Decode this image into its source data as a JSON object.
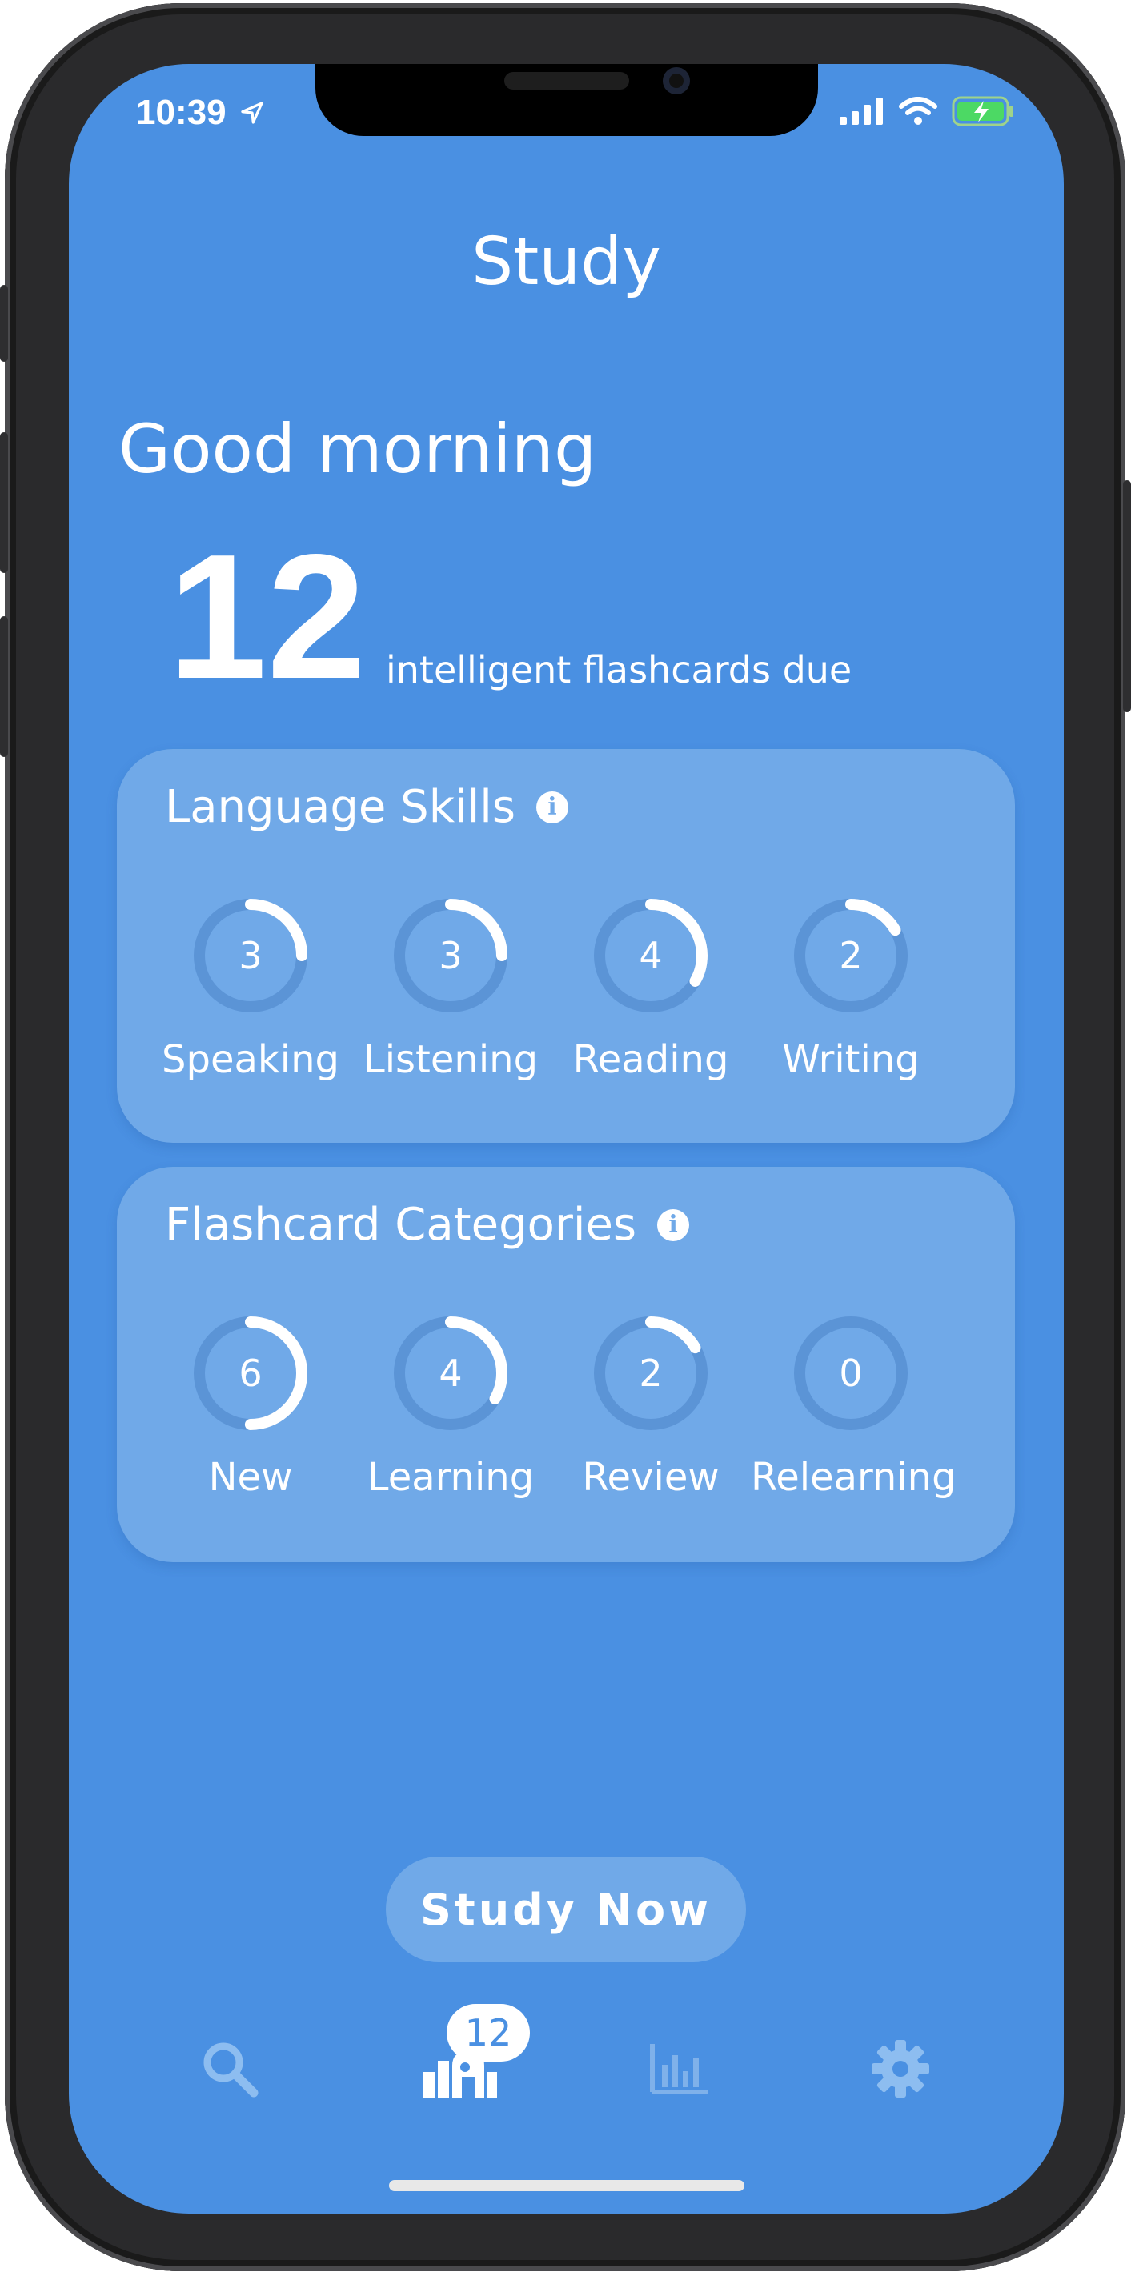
{
  "status_bar": {
    "time": "10:39"
  },
  "header": {
    "title": "Study"
  },
  "greeting": "Good morning",
  "due": {
    "count": "12",
    "label": "intelligent flashcards due"
  },
  "language_skills": {
    "title": "Language Skills",
    "items": [
      {
        "label": "Speaking",
        "value": "3",
        "progress": 0.25
      },
      {
        "label": "Listening",
        "value": "3",
        "progress": 0.25
      },
      {
        "label": "Reading",
        "value": "4",
        "progress": 0.333
      },
      {
        "label": "Writing",
        "value": "2",
        "progress": 0.167
      }
    ]
  },
  "flashcard_categories": {
    "title": "Flashcard Categories",
    "items": [
      {
        "label": "New",
        "value": "6",
        "progress": 0.5
      },
      {
        "label": "Learning",
        "value": "4",
        "progress": 0.333
      },
      {
        "label": "Review",
        "value": "2",
        "progress": 0.167
      },
      {
        "label": "Relearning",
        "value": "0",
        "progress": 0
      }
    ]
  },
  "study_button": {
    "label": "Study Now"
  },
  "tab_bar": {
    "tabs": [
      {
        "icon": "search-icon"
      },
      {
        "icon": "study-icon",
        "badge": "12"
      },
      {
        "icon": "stats-icon"
      },
      {
        "icon": "gear-icon"
      }
    ]
  },
  "colors": {
    "background": "#4a90e2",
    "card": "#70a9e8",
    "ring_track": "#5b94d6",
    "ring_fill": "#ffffff"
  }
}
